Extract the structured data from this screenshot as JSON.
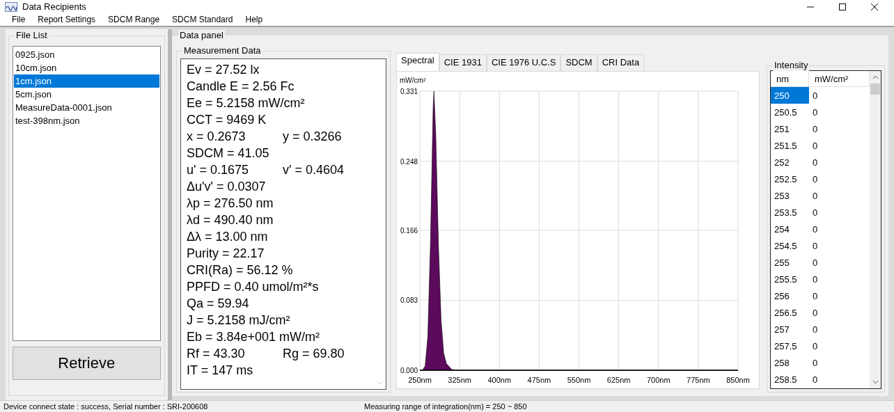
{
  "window": {
    "title": "Data Recipients"
  },
  "menu": [
    "File",
    "Report Settings",
    "SDCM Range",
    "SDCM Standard",
    "Help"
  ],
  "file_list": {
    "title": "File List",
    "items": [
      {
        "label": "0925.json",
        "selected": false
      },
      {
        "label": "10cm.json",
        "selected": false
      },
      {
        "label": "1cm.json",
        "selected": true
      },
      {
        "label": "5cm.json",
        "selected": false
      },
      {
        "label": "MeasureData-0001.json",
        "selected": false
      },
      {
        "label": "test-398nm.json",
        "selected": false
      }
    ],
    "button": "Retrieve"
  },
  "data_panel": {
    "title": "Data panel",
    "measurement": {
      "title": "Measurement Data",
      "lines": [
        [
          "Ev = 27.52 lx"
        ],
        [
          "Candle E = 2.56 Fc"
        ],
        [
          "Ee = 5.2158 mW/cm²"
        ],
        [
          "CCT = 9469 K"
        ],
        [
          "x = 0.2673",
          "y = 0.3266"
        ],
        [
          "SDCM = 41.05"
        ],
        [
          "u' = 0.1675",
          "v' = 0.4604"
        ],
        [
          "Δu'v' = 0.0307"
        ],
        [
          "λp = 276.50 nm"
        ],
        [
          "λd = 490.40 nm"
        ],
        [
          "Δλ = 13.00 nm"
        ],
        [
          "Purity = 22.17"
        ],
        [
          "CRI(Ra) = 56.12 %"
        ],
        [
          "PPFD = 0.40 umol/m²*s"
        ],
        [
          "Qa = 59.94"
        ],
        [
          "J = 5.2158 mJ/cm²"
        ],
        [
          "Eb = 3.84e+001 mW/m²"
        ],
        [
          "Rf = 43.30",
          "Rg = 69.80"
        ],
        [
          "IT = 147 ms"
        ]
      ]
    },
    "tabs": [
      {
        "label": "Spectral",
        "selected": true
      },
      {
        "label": "CIE 1931",
        "selected": false
      },
      {
        "label": "CIE 1976 U.C.S",
        "selected": false
      },
      {
        "label": "SDCM",
        "selected": false
      },
      {
        "label": "CRI Data",
        "selected": false
      }
    ],
    "chart_data": {
      "type": "area",
      "ylabel": "mW/cm²",
      "grid": true,
      "x": [
        250,
        255,
        260,
        265,
        270,
        275,
        276.5,
        280,
        285,
        290,
        295,
        300,
        310,
        320,
        850
      ],
      "series": [
        {
          "color": "#5c0a5c",
          "values": [
            0,
            0,
            0.005,
            0.04,
            0.15,
            0.31,
            0.331,
            0.28,
            0.15,
            0.06,
            0.02,
            0.008,
            0.001,
            0,
            0
          ]
        }
      ],
      "xlim": [
        250,
        850
      ],
      "ylim": [
        0,
        0.331
      ],
      "xticks": [
        {
          "value": 250,
          "label": "250nm"
        },
        {
          "value": 325,
          "label": "325nm"
        },
        {
          "value": 400,
          "label": "400nm"
        },
        {
          "value": 475,
          "label": "475nm"
        },
        {
          "value": 550,
          "label": "550nm"
        },
        {
          "value": 625,
          "label": "625nm"
        },
        {
          "value": 700,
          "label": "700nm"
        },
        {
          "value": 775,
          "label": "775nm"
        },
        {
          "value": 850,
          "label": "850nm"
        }
      ],
      "yticks": [
        {
          "value": 0,
          "label": "0.000"
        },
        {
          "value": 0.083,
          "label": "0.083"
        },
        {
          "value": 0.166,
          "label": "0.166"
        },
        {
          "value": 0.248,
          "label": "0.248"
        },
        {
          "value": 0.331,
          "label": "0.331"
        }
      ]
    },
    "intensity": {
      "title": "Intensity",
      "columns": [
        "nm",
        "mW/cm²"
      ],
      "rows": [
        {
          "nm": "250",
          "value": "0",
          "selected": true
        },
        {
          "nm": "250.5",
          "value": "0",
          "selected": false
        },
        {
          "nm": "251",
          "value": "0",
          "selected": false
        },
        {
          "nm": "251.5",
          "value": "0",
          "selected": false
        },
        {
          "nm": "252",
          "value": "0",
          "selected": false
        },
        {
          "nm": "252.5",
          "value": "0",
          "selected": false
        },
        {
          "nm": "253",
          "value": "0",
          "selected": false
        },
        {
          "nm": "253.5",
          "value": "0",
          "selected": false
        },
        {
          "nm": "254",
          "value": "0",
          "selected": false
        },
        {
          "nm": "254.5",
          "value": "0",
          "selected": false
        },
        {
          "nm": "255",
          "value": "0",
          "selected": false
        },
        {
          "nm": "255.5",
          "value": "0",
          "selected": false
        },
        {
          "nm": "256",
          "value": "0",
          "selected": false
        },
        {
          "nm": "256.5",
          "value": "0",
          "selected": false
        },
        {
          "nm": "257",
          "value": "0",
          "selected": false
        },
        {
          "nm": "257.5",
          "value": "0",
          "selected": false
        },
        {
          "nm": "258",
          "value": "0",
          "selected": false
        },
        {
          "nm": "258.5",
          "value": "0",
          "selected": false
        }
      ]
    }
  },
  "status_bar": {
    "device": "Device connect state : success, Serial number : SRI-200608",
    "range": "Measuring range of integration(nm) = 250 ~ 850"
  }
}
